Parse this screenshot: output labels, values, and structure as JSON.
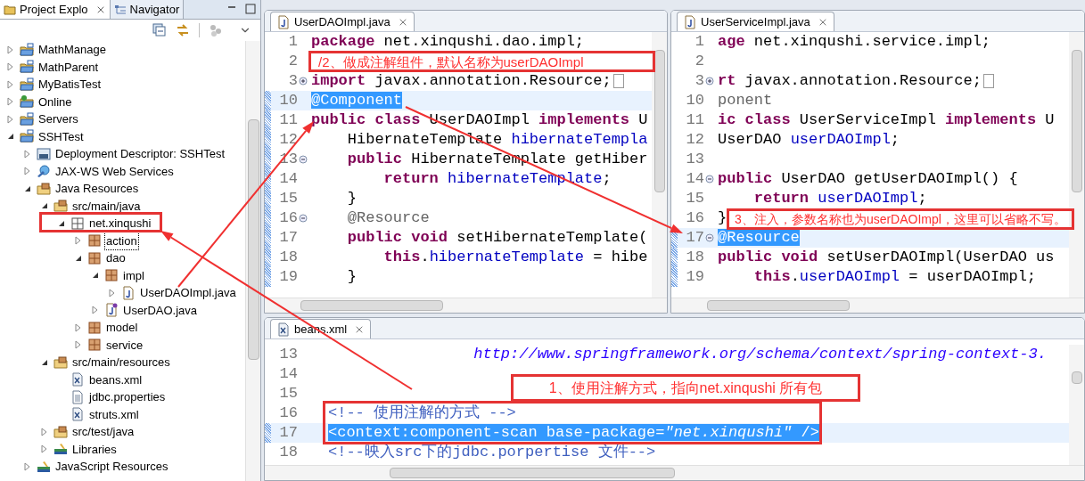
{
  "explorer": {
    "tabs": [
      {
        "label": "Project Explo",
        "selected": true,
        "kind": "explorer"
      },
      {
        "label": "Navigator",
        "selected": false,
        "kind": "navigator"
      }
    ],
    "tree": [
      {
        "label": "MathManage",
        "kind": "maven-project",
        "expanded": false
      },
      {
        "label": "MathParent",
        "kind": "maven-project",
        "expanded": false
      },
      {
        "label": "MyBatisTest",
        "kind": "project",
        "expanded": false
      },
      {
        "label": "Online",
        "kind": "web-project",
        "expanded": false
      },
      {
        "label": "Servers",
        "kind": "project",
        "expanded": false
      },
      {
        "label": "SSHTest",
        "kind": "maven-project",
        "expanded": true,
        "children": [
          {
            "label": "Deployment Descriptor: SSHTest",
            "kind": "descriptor",
            "expanded": false
          },
          {
            "label": "JAX-WS Web Services",
            "kind": "webservices",
            "expanded": false
          },
          {
            "label": "Java Resources",
            "kind": "java-resources",
            "expanded": true,
            "children": [
              {
                "label": "src/main/java",
                "kind": "source-folder",
                "expanded": true,
                "children": [
                  {
                    "label": "net.xinqushi",
                    "kind": "empty-package",
                    "expanded": true,
                    "children": [
                      {
                        "label": "action",
                        "kind": "package",
                        "expanded": false,
                        "focused": true
                      },
                      {
                        "label": "dao",
                        "kind": "package",
                        "expanded": true,
                        "children": [
                          {
                            "label": "impl",
                            "kind": "package",
                            "expanded": true,
                            "children": [
                              {
                                "label": "UserDAOImpl.java",
                                "kind": "java-file",
                                "expanded": false
                              }
                            ]
                          },
                          {
                            "label": "UserDAO.java",
                            "kind": "interface-file",
                            "expanded": false
                          }
                        ]
                      },
                      {
                        "label": "model",
                        "kind": "package",
                        "expanded": false
                      },
                      {
                        "label": "service",
                        "kind": "package",
                        "expanded": false
                      }
                    ]
                  }
                ]
              },
              {
                "label": "src/main/resources",
                "kind": "source-folder",
                "expanded": true,
                "children": [
                  {
                    "label": "beans.xml",
                    "kind": "xml-file"
                  },
                  {
                    "label": "jdbc.properties",
                    "kind": "properties-file"
                  },
                  {
                    "label": "struts.xml",
                    "kind": "xml-file"
                  }
                ]
              },
              {
                "label": "src/test/java",
                "kind": "source-folder",
                "expanded": false
              },
              {
                "label": "Libraries",
                "kind": "libraries",
                "expanded": false
              }
            ]
          },
          {
            "label": "JavaScript Resources",
            "kind": "libraries",
            "expanded": false
          }
        ]
      }
    ]
  },
  "editors": [
    {
      "tab": "UserDAOImpl.java",
      "kind": "java",
      "lines": [
        {
          "number": "1",
          "highlighted": false,
          "changed": false,
          "tokens": [
            {
              "text": "package",
              "kind": "keyword"
            },
            {
              "text": " net.xinqushi.dao.impl;",
              "kind": "plain"
            }
          ]
        },
        {
          "number": "2",
          "highlighted": false,
          "changed": false
        },
        {
          "number": "3",
          "highlighted": false,
          "changed": false,
          "collapsed": true,
          "tokens": [
            {
              "text": "import",
              "kind": "keyword"
            },
            {
              "text": " javax.annotation.Resource;",
              "kind": "plain"
            }
          ]
        },
        {
          "number": "10",
          "highlighted": true,
          "changed": true,
          "tokens": [
            {
              "text": "@Component",
              "kind": "selection"
            }
          ]
        },
        {
          "number": "11",
          "highlighted": false,
          "changed": true,
          "tokens": [
            {
              "text": "public class",
              "kind": "keyword"
            },
            {
              "text": " UserDAOImpl ",
              "kind": "plain"
            },
            {
              "text": "implements",
              "kind": "keyword"
            },
            {
              "text": " U",
              "kind": "plain"
            }
          ]
        },
        {
          "number": "12",
          "highlighted": false,
          "changed": true,
          "tokens": [
            {
              "text": "    HibernateTemplate ",
              "kind": "plain"
            },
            {
              "text": "hibernateTempla",
              "kind": "field"
            }
          ]
        },
        {
          "number": "13",
          "highlighted": false,
          "changed": true,
          "collapsed": false,
          "tokens": [
            {
              "text": "    public",
              "kind": "keyword"
            },
            {
              "text": " HibernateTemplate getHiber",
              "kind": "plain"
            }
          ]
        },
        {
          "number": "14",
          "highlighted": false,
          "changed": true,
          "tokens": [
            {
              "text": "        return",
              "kind": "keyword"
            },
            {
              "text": " hibernateTemplate",
              "kind": "field"
            },
            {
              "text": ";",
              "kind": "plain"
            }
          ]
        },
        {
          "number": "15",
          "highlighted": false,
          "changed": true,
          "tokens": [
            {
              "text": "    }",
              "kind": "plain"
            }
          ]
        },
        {
          "number": "16",
          "highlighted": false,
          "changed": true,
          "collapsed": false,
          "tokens": [
            {
              "text": "    @Resource",
              "kind": "annotation"
            }
          ]
        },
        {
          "number": "17",
          "highlighted": false,
          "changed": true,
          "tokens": [
            {
              "text": "    public void",
              "kind": "keyword"
            },
            {
              "text": " setHibernateTemplate(",
              "kind": "plain"
            }
          ]
        },
        {
          "number": "18",
          "highlighted": false,
          "changed": true,
          "tokens": [
            {
              "text": "        this",
              "kind": "keyword"
            },
            {
              "text": ".",
              "kind": "plain"
            },
            {
              "text": "hibernateTemplate",
              "kind": "field"
            },
            {
              "text": " = hibe",
              "kind": "plain"
            }
          ]
        },
        {
          "number": "19",
          "highlighted": false,
          "changed": true,
          "tokens": [
            {
              "text": "    }",
              "kind": "plain"
            }
          ]
        }
      ]
    },
    {
      "tab": "UserServiceImpl.java",
      "kind": "java",
      "lines": [
        {
          "number": "1",
          "highlighted": false,
          "changed": false,
          "tokens": [
            {
              "text": "age",
              "kind": "keyword"
            },
            {
              "text": " net.xinqushi.service.impl;",
              "kind": "plain"
            }
          ]
        },
        {
          "number": "2",
          "highlighted": false,
          "changed": false
        },
        {
          "number": "3",
          "highlighted": false,
          "changed": false,
          "collapsed": true,
          "tokens": [
            {
              "text": "rt",
              "kind": "keyword"
            },
            {
              "text": " javax.annotation.Resource;",
              "kind": "plain"
            }
          ]
        },
        {
          "number": "10",
          "highlighted": false,
          "changed": false,
          "tokens": [
            {
              "text": "ponent",
              "kind": "annotation"
            }
          ]
        },
        {
          "number": "11",
          "highlighted": false,
          "changed": false,
          "tokens": [
            {
              "text": "ic class",
              "kind": "keyword"
            },
            {
              "text": " UserServiceImpl ",
              "kind": "plain"
            },
            {
              "text": "implements",
              "kind": "keyword"
            },
            {
              "text": " U",
              "kind": "plain"
            }
          ]
        },
        {
          "number": "12",
          "highlighted": false,
          "changed": false,
          "tokens": [
            {
              "text": "UserDAO ",
              "kind": "plain"
            },
            {
              "text": "userDAOImpl",
              "kind": "field"
            },
            {
              "text": ";",
              "kind": "plain"
            }
          ]
        },
        {
          "number": "13",
          "highlighted": false,
          "changed": false
        },
        {
          "number": "14",
          "highlighted": false,
          "changed": false,
          "collapsed": false,
          "tokens": [
            {
              "text": "public",
              "kind": "keyword"
            },
            {
              "text": " UserDAO getUserDAOImpl() {",
              "kind": "plain"
            }
          ]
        },
        {
          "number": "15",
          "highlighted": false,
          "changed": false,
          "tokens": [
            {
              "text": "    return",
              "kind": "keyword"
            },
            {
              "text": " userDAOImpl",
              "kind": "field"
            },
            {
              "text": ";",
              "kind": "plain"
            }
          ]
        },
        {
          "number": "16",
          "highlighted": false,
          "changed": false,
          "tokens": [
            {
              "text": "}",
              "kind": "plain"
            }
          ]
        },
        {
          "number": "17",
          "highlighted": true,
          "changed": true,
          "collapsed": false,
          "tokens": [
            {
              "text": "@Resource",
              "kind": "selection"
            }
          ]
        },
        {
          "number": "18",
          "highlighted": false,
          "changed": true,
          "tokens": [
            {
              "text": "public void",
              "kind": "keyword"
            },
            {
              "text": " setUserDAOImpl(UserDAO us",
              "kind": "plain"
            }
          ]
        },
        {
          "number": "19",
          "highlighted": false,
          "changed": true,
          "tokens": [
            {
              "text": "    this",
              "kind": "keyword"
            },
            {
              "text": ".",
              "kind": "plain"
            },
            {
              "text": "userDAOImpl",
              "kind": "field"
            },
            {
              "text": " = userDAOImpl;",
              "kind": "plain"
            }
          ]
        }
      ]
    },
    {
      "tab": "beans.xml",
      "kind": "xml",
      "lines": [
        {
          "number": "13",
          "highlighted": false,
          "changed": false,
          "tokens": [
            {
              "text": "                http://www.springframework.org/schema/context/spring-context-3.",
              "kind": "string"
            }
          ]
        },
        {
          "number": "14",
          "highlighted": false,
          "changed": false
        },
        {
          "number": "15",
          "highlighted": false,
          "changed": false
        },
        {
          "number": "16",
          "highlighted": false,
          "changed": false,
          "tokens": [
            {
              "text": "<!-- 使用注解的方式 -->",
              "kind": "comment"
            }
          ]
        },
        {
          "number": "17",
          "highlighted": true,
          "changed": true,
          "tokens": [
            {
              "text": "<context:component-scan base-package=",
              "kind": "selection"
            },
            {
              "text": "\"net.xinqushi\"",
              "kind": "selection-string"
            },
            {
              "text": " />",
              "kind": "selection"
            }
          ]
        },
        {
          "number": "18",
          "highlighted": false,
          "changed": false,
          "tokens": [
            {
              "text": "<!--映入src下的jdbc.porpertise 文件-->",
              "kind": "comment"
            }
          ]
        }
      ]
    }
  ],
  "callouts": [
    {
      "text": "/2、做成注解组件，默认名称为userDAOImpl"
    },
    {
      "text": "3、注入，参数名称也为userDAOImpl，这里可以省略不写。"
    },
    {
      "text": "1、使用注解方式，指向net.xinqushi 所有包"
    }
  ]
}
